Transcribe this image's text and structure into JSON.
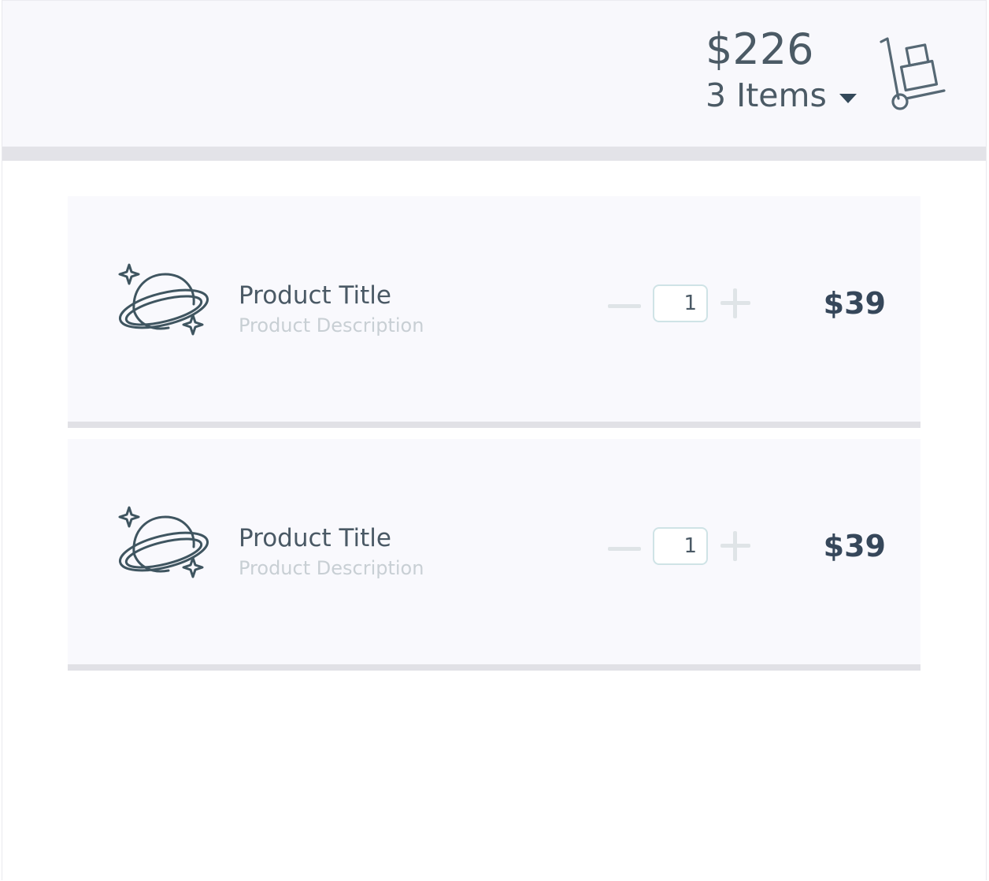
{
  "header": {
    "cart_total": "$226",
    "cart_count": "3 Items",
    "cart_icon": "hand-truck-cart-icon",
    "dropdown_icon": "caret-down-icon"
  },
  "items": [
    {
      "icon": "planet-icon",
      "title": "Product Title",
      "description": "Product Description",
      "quantity": "1",
      "price": "$39"
    },
    {
      "icon": "planet-icon",
      "title": "Product Title",
      "description": "Product Description",
      "quantity": "1",
      "price": "$39"
    }
  ],
  "colors": {
    "header_bg": "#f8f8fc",
    "item_bg": "#f9f9fd",
    "text_dark": "#36475a",
    "text_muted": "#c8cfd4",
    "qty_border": "#cfe3e6"
  }
}
